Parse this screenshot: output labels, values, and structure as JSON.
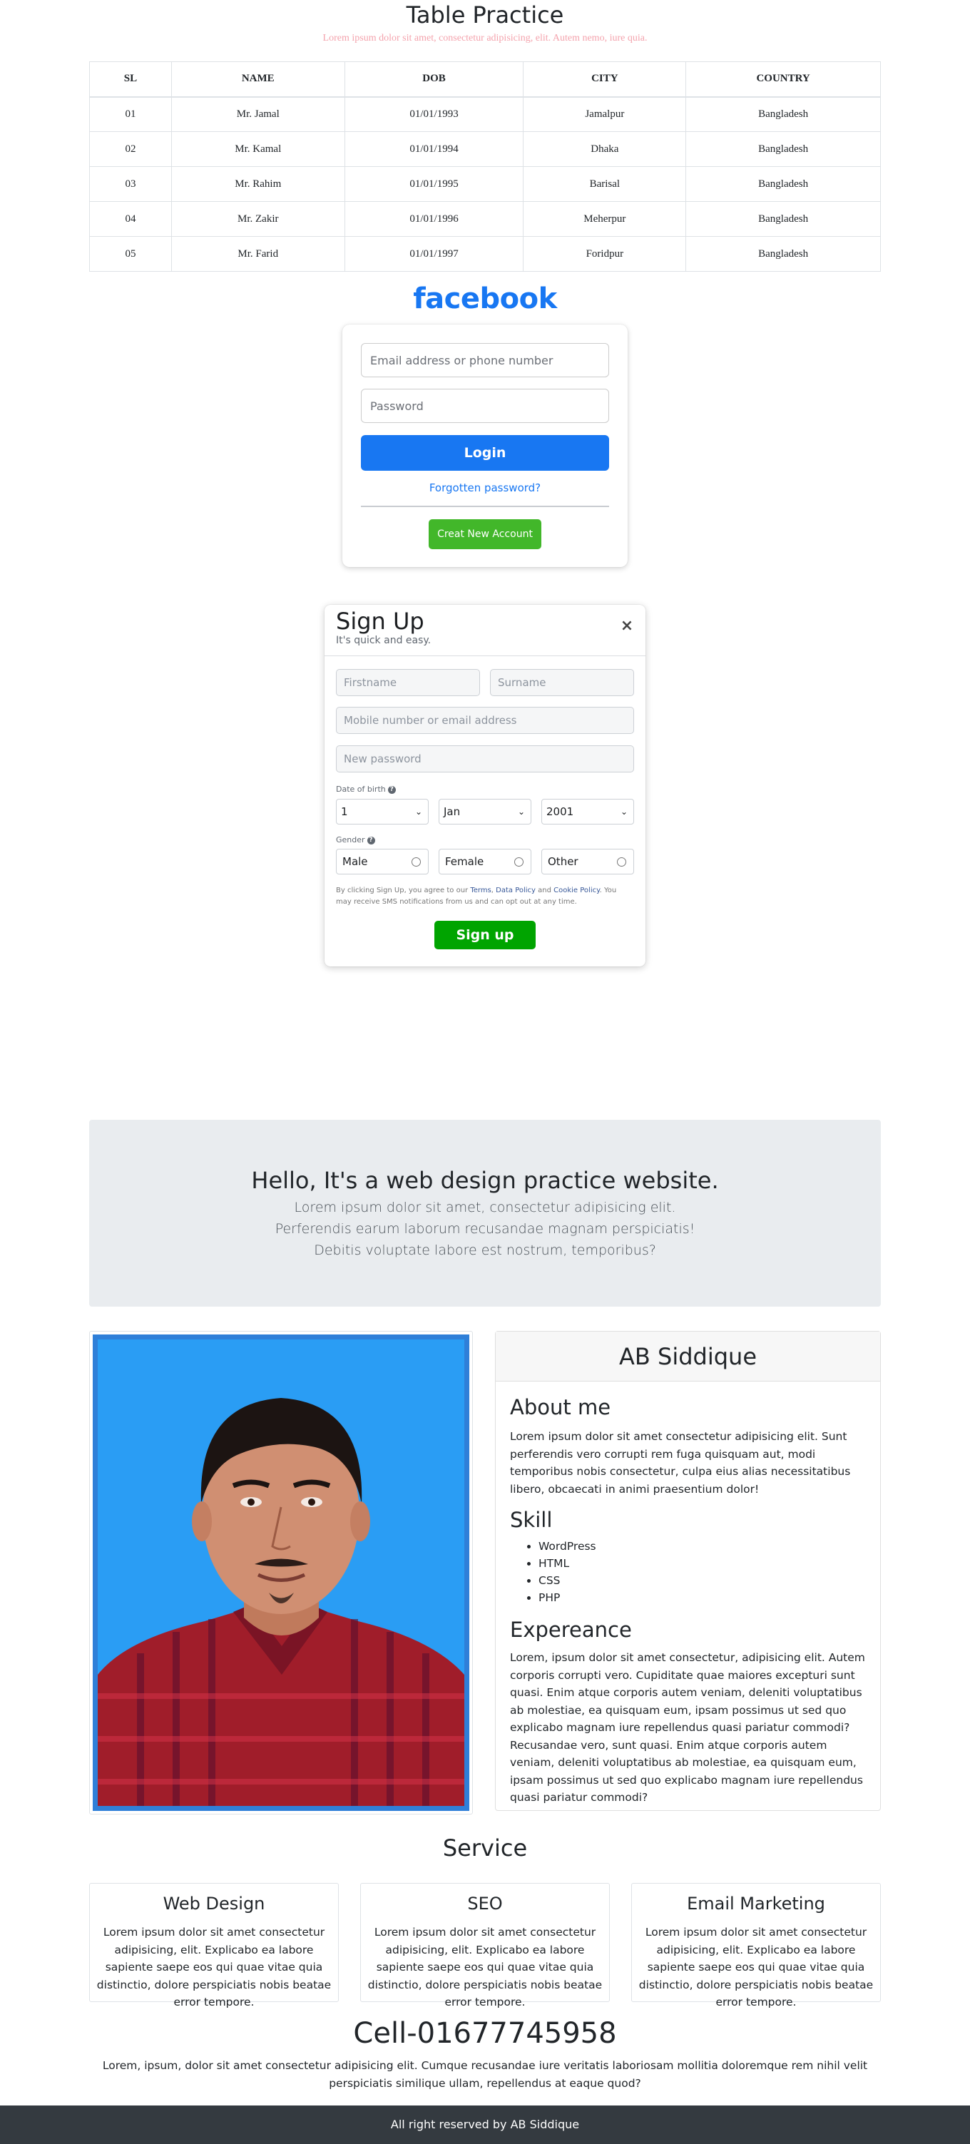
{
  "header": {
    "title": "Table Practice",
    "subtitle": "Lorem ipsum dolor sit amet, consectetur adipisicing, elit. Autem nemo, iure quia."
  },
  "table": {
    "columns": [
      "SL",
      "NAME",
      "DOB",
      "CITY",
      "COUNTRY"
    ],
    "rows": [
      [
        "01",
        "Mr. Jamal",
        "01/01/1993",
        "Jamalpur",
        "Bangladesh"
      ],
      [
        "02",
        "Mr. Kamal",
        "01/01/1994",
        "Dhaka",
        "Bangladesh"
      ],
      [
        "03",
        "Mr. Rahim",
        "01/01/1995",
        "Barisal",
        "Bangladesh"
      ],
      [
        "04",
        "Mr. Zakir",
        "01/01/1996",
        "Meherpur",
        "Bangladesh"
      ],
      [
        "05",
        "Mr. Farid",
        "01/01/1997",
        "Foridpur",
        "Bangladesh"
      ]
    ]
  },
  "login": {
    "logo": "facebook",
    "email_placeholder": "Email address or phone number",
    "password_placeholder": "Password",
    "login_label": "Login",
    "forgot_label": "Forgotten password?",
    "create_label": "Creat New Account"
  },
  "signup": {
    "title": "Sign Up",
    "subtitle": "It's quick and easy.",
    "close": "×",
    "firstname_placeholder": "Firstname",
    "surname_placeholder": "Surname",
    "mobile_placeholder": "Mobile number or email address",
    "password_placeholder": "New password",
    "dob_label": "Date of birth",
    "dob_day": "1",
    "dob_month": "Jan",
    "dob_year": "2001",
    "gender_label": "Gender",
    "genders": [
      "Male",
      "Female",
      "Other"
    ],
    "help": "?",
    "terms_before": "By clicking Sign Up, you agree to our ",
    "terms_link": "Terms",
    "terms_sep1": ", ",
    "data_link": "Data Policy",
    "terms_and": " and ",
    "cookie_link": "Cookie Policy",
    "terms_after": ". You may receive SMS notifications from us and can opt out at any time.",
    "signup_label": "Sign up"
  },
  "hero": {
    "title": "Hello, It's a web design practice website.",
    "lines": [
      "Lorem ipsum dolor sit amet, consectetur adipisicing elit.",
      "Perferendis earum laborum recusandae magnam perspiciatis!",
      "Debitis voluptate labore est nostrum, temporibus?"
    ]
  },
  "profile": {
    "name": "AB Siddique",
    "about_heading": "About me",
    "about_text": "Lorem ipsum dolor sit amet consectetur adipisicing elit. Sunt perferendis vero corrupti rem fuga quisquam aut, modi temporibus nobis consectetur, culpa eius alias necessitatibus libero, obcaecati in animi praesentium dolor!",
    "skill_heading": "Skill",
    "skills": [
      "WordPress",
      "HTML",
      "CSS",
      "PHP"
    ],
    "exp_heading": "Expereance",
    "exp_text": "Lorem, ipsum dolor sit amet consectetur, adipisicing elit. Autem corporis corrupti vero. Cupiditate quae maiores excepturi sunt quasi. Enim atque corporis autem veniam, deleniti voluptatibus ab molestiae, ea quisquam eum, ipsam possimus ut sed quo explicabo magnam iure repellendus quasi pariatur commodi? Recusandae vero, sunt quasi. Enim atque corporis autem veniam, deleniti voluptatibus ab molestiae, ea quisquam eum, ipsam possimus ut sed quo explicabo magnam iure repellendus quasi pariatur commodi?"
  },
  "service": {
    "title": "Service",
    "cards": [
      {
        "title": "Web Design",
        "text": "Lorem ipsum dolor sit amet consectetur adipisicing, elit. Explicabo ea labore sapiente saepe eos qui quae vitae quia distinctio, dolore perspiciatis nobis beatae error tempore."
      },
      {
        "title": "SEO",
        "text": "Lorem ipsum dolor sit amet consectetur adipisicing, elit. Explicabo ea labore sapiente saepe eos qui quae vitae quia distinctio, dolore perspiciatis nobis beatae error tempore."
      },
      {
        "title": "Email Marketing",
        "text": "Lorem ipsum dolor sit amet consectetur adipisicing, elit. Explicabo ea labore sapiente saepe eos qui quae vitae quia distinctio, dolore perspiciatis nobis beatae error tempore."
      }
    ]
  },
  "contact": {
    "title": "Cell-01677745958",
    "text": "Lorem, ipsum, dolor sit amet consectetur adipisicing elit. Cumque recusandae iure veritatis laboriosam mollitia doloremque rem nihil velit perspiciatis similique ullam, repellendus at eaque quod?"
  },
  "footer": {
    "text": "All right reserved by AB Siddique"
  },
  "colors": {
    "fb_blue": "#1877f2",
    "fb_green": "#42b72a",
    "signup_green": "#00a400",
    "photo_bg": "#2a9df4",
    "footer_bg": "#343a40",
    "hero_bg": "#e9ecef"
  }
}
